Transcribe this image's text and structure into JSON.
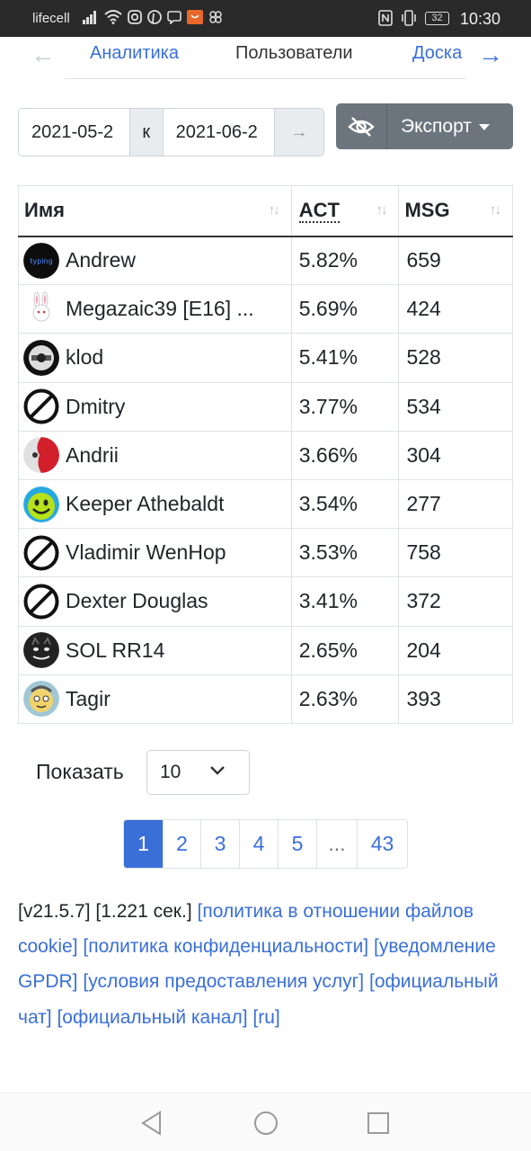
{
  "status_bar": {
    "carrier": "lifecell",
    "battery": "32",
    "time": "10:30"
  },
  "tabs": {
    "analytics": "Аналитика",
    "users": "Пользователи",
    "board": "Доска"
  },
  "date_range": {
    "from": "2021-05-2",
    "separator": "к",
    "to": "2021-06-2",
    "go": "→"
  },
  "toolbar": {
    "export_label": "Экспорт"
  },
  "table": {
    "headers": {
      "name": "Имя",
      "act": "ACT",
      "msg": "MSG"
    },
    "rows": [
      {
        "name": "Andrew",
        "act": "5.82%",
        "msg": "659",
        "avatar": "typing-avatar"
      },
      {
        "name": "Megazaic39 [E16] ...",
        "act": "5.69%",
        "msg": "424",
        "avatar": "bunny-avatar"
      },
      {
        "name": "klod",
        "act": "5.41%",
        "msg": "528",
        "avatar": "round-badge-avatar"
      },
      {
        "name": "Dmitry",
        "act": "3.77%",
        "msg": "534",
        "avatar": "no-photo-avatar"
      },
      {
        "name": "Andrii",
        "act": "3.66%",
        "msg": "304",
        "avatar": "red-splash-avatar"
      },
      {
        "name": "Keeper Athebaldt",
        "act": "3.54%",
        "msg": "277",
        "avatar": "smiley-avatar"
      },
      {
        "name": "Vladimir WenHop",
        "act": "3.53%",
        "msg": "758",
        "avatar": "no-photo-avatar"
      },
      {
        "name": "Dexter Douglas",
        "act": "3.41%",
        "msg": "372",
        "avatar": "no-photo-avatar"
      },
      {
        "name": "SOL RR14",
        "act": "2.65%",
        "msg": "204",
        "avatar": "dark-cat-avatar"
      },
      {
        "name": "Tagir",
        "act": "2.63%",
        "msg": "393",
        "avatar": "cartoon-avatar"
      }
    ]
  },
  "page_size": {
    "label": "Показать",
    "value": "10"
  },
  "pagination": {
    "pages": [
      "1",
      "2",
      "3",
      "4",
      "5",
      "...",
      "43"
    ],
    "active": "1"
  },
  "footer": {
    "version": "[v21.5.7]",
    "timing": "[1.221 сек.]",
    "links": [
      "[политика в отношении файлов cookie]",
      "[политика конфиденциальности]",
      "[уведомление GPDR]",
      "[условия предоставления услуг]",
      "[официальный чат]",
      "[официальный канал]",
      "[ru]"
    ]
  },
  "colors": {
    "accent": "#3a6fd8",
    "secondary_button": "#6c757d",
    "status_bar": "#2a2a2a"
  }
}
